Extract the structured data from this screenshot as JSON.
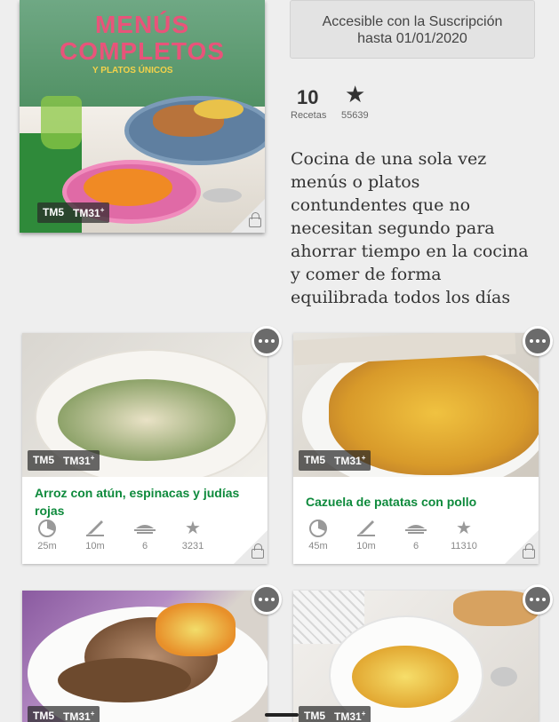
{
  "book": {
    "cover_title_line1": "MENÚS",
    "cover_title_line2": "COMPLETOS",
    "cover_subtitle": "Y PLATOS ÚNICOS",
    "badge_tm5": "TM5",
    "badge_tm31": "TM31",
    "badge_sup": "+"
  },
  "subscription": {
    "line1": "Accesible con la Suscripción",
    "line2": "hasta 01/01/2020"
  },
  "stats": {
    "recipes_count": "10",
    "recipes_label": "Recetas",
    "star_glyph": "★",
    "rating_count": "55639"
  },
  "description": "Cocina de una sola vez menús o platos contundentes que no necesitan segundo para ahorrar tiempo en la cocina y comer de forma equilibrada todos los días",
  "recipes": [
    {
      "title": "Arroz con atún, espinacas y judías rojas",
      "badge_tm5": "TM5",
      "badge_tm31": "TM31",
      "badge_sup": "+",
      "total_time": "25m",
      "prep_time": "10m",
      "servings": "6",
      "rating_count": "3231"
    },
    {
      "title": "Cazuela de patatas con pollo",
      "badge_tm5": "TM5",
      "badge_tm31": "TM31",
      "badge_sup": "+",
      "total_time": "45m",
      "prep_time": "10m",
      "servings": "6",
      "rating_count": "11310"
    },
    {
      "badge_tm5": "TM5",
      "badge_tm31": "TM31",
      "badge_sup": "+"
    },
    {
      "badge_tm5": "TM5",
      "badge_tm31": "TM31",
      "badge_sup": "+"
    }
  ],
  "colors": {
    "accent_green": "#0e8a3c",
    "cover_title_pink": "#e8547a",
    "background": "#eeeeee"
  },
  "icons": [
    "timer-icon",
    "knife-icon",
    "servings-icon",
    "star-icon",
    "lock-icon",
    "more-options-icon"
  ]
}
